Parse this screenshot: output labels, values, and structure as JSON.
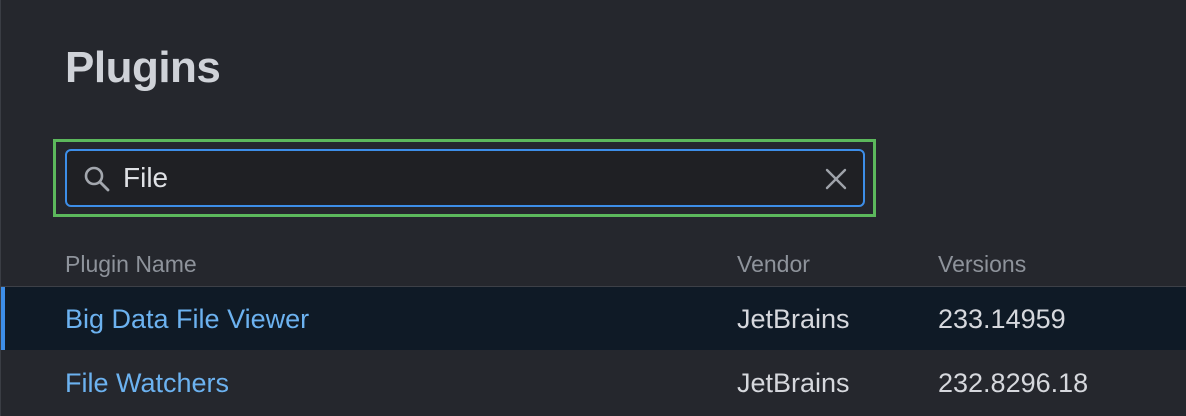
{
  "page": {
    "title": "Plugins"
  },
  "search": {
    "value": "File",
    "icon": "search-icon",
    "clear_icon": "close-icon"
  },
  "table": {
    "columns": [
      "Plugin Name",
      "Vendor",
      "Versions"
    ],
    "rows": [
      {
        "name": "Big Data File Viewer",
        "vendor": "JetBrains",
        "version": "233.14959",
        "selected": true
      },
      {
        "name": "File Watchers",
        "vendor": "JetBrains",
        "version": "232.8296.18",
        "selected": false
      }
    ]
  },
  "colors": {
    "background": "#25272d",
    "accent": "#3d8ee8",
    "link": "#6cb2f0",
    "highlight_box": "#5cb85c",
    "selected_row": "#0f1a26"
  }
}
